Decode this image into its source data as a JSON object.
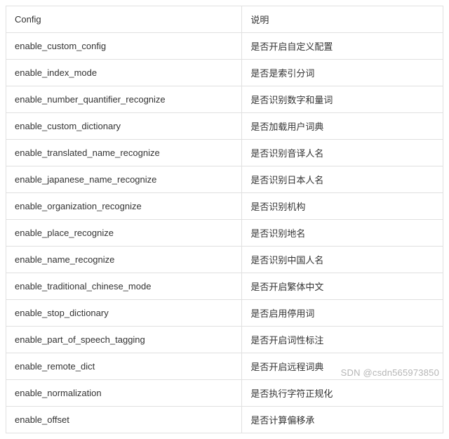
{
  "headers": {
    "config": "Config",
    "description": "说明"
  },
  "rows": [
    {
      "config": "enable_custom_config",
      "description": "是否开启自定义配置"
    },
    {
      "config": "enable_index_mode",
      "description": "是否是索引分词"
    },
    {
      "config": "enable_number_quantifier_recognize",
      "description": "是否识别数字和量词"
    },
    {
      "config": "enable_custom_dictionary",
      "description": "是否加载用户词典"
    },
    {
      "config": "enable_translated_name_recognize",
      "description": "是否识别音译人名"
    },
    {
      "config": "enable_japanese_name_recognize",
      "description": "是否识别日本人名"
    },
    {
      "config": "enable_organization_recognize",
      "description": "是否识别机构"
    },
    {
      "config": "enable_place_recognize",
      "description": "是否识别地名"
    },
    {
      "config": "enable_name_recognize",
      "description": "是否识别中国人名"
    },
    {
      "config": "enable_traditional_chinese_mode",
      "description": "是否开启繁体中文"
    },
    {
      "config": "enable_stop_dictionary",
      "description": "是否启用停用词"
    },
    {
      "config": "enable_part_of_speech_tagging",
      "description": "是否开启词性标注"
    },
    {
      "config": "enable_remote_dict",
      "description": "是否开启远程词典"
    },
    {
      "config": "enable_normalization",
      "description": "是否执行字符正规化"
    },
    {
      "config": "enable_offset",
      "description": "是否计算偏移承"
    }
  ],
  "watermark": "SDN @csdn565973850"
}
